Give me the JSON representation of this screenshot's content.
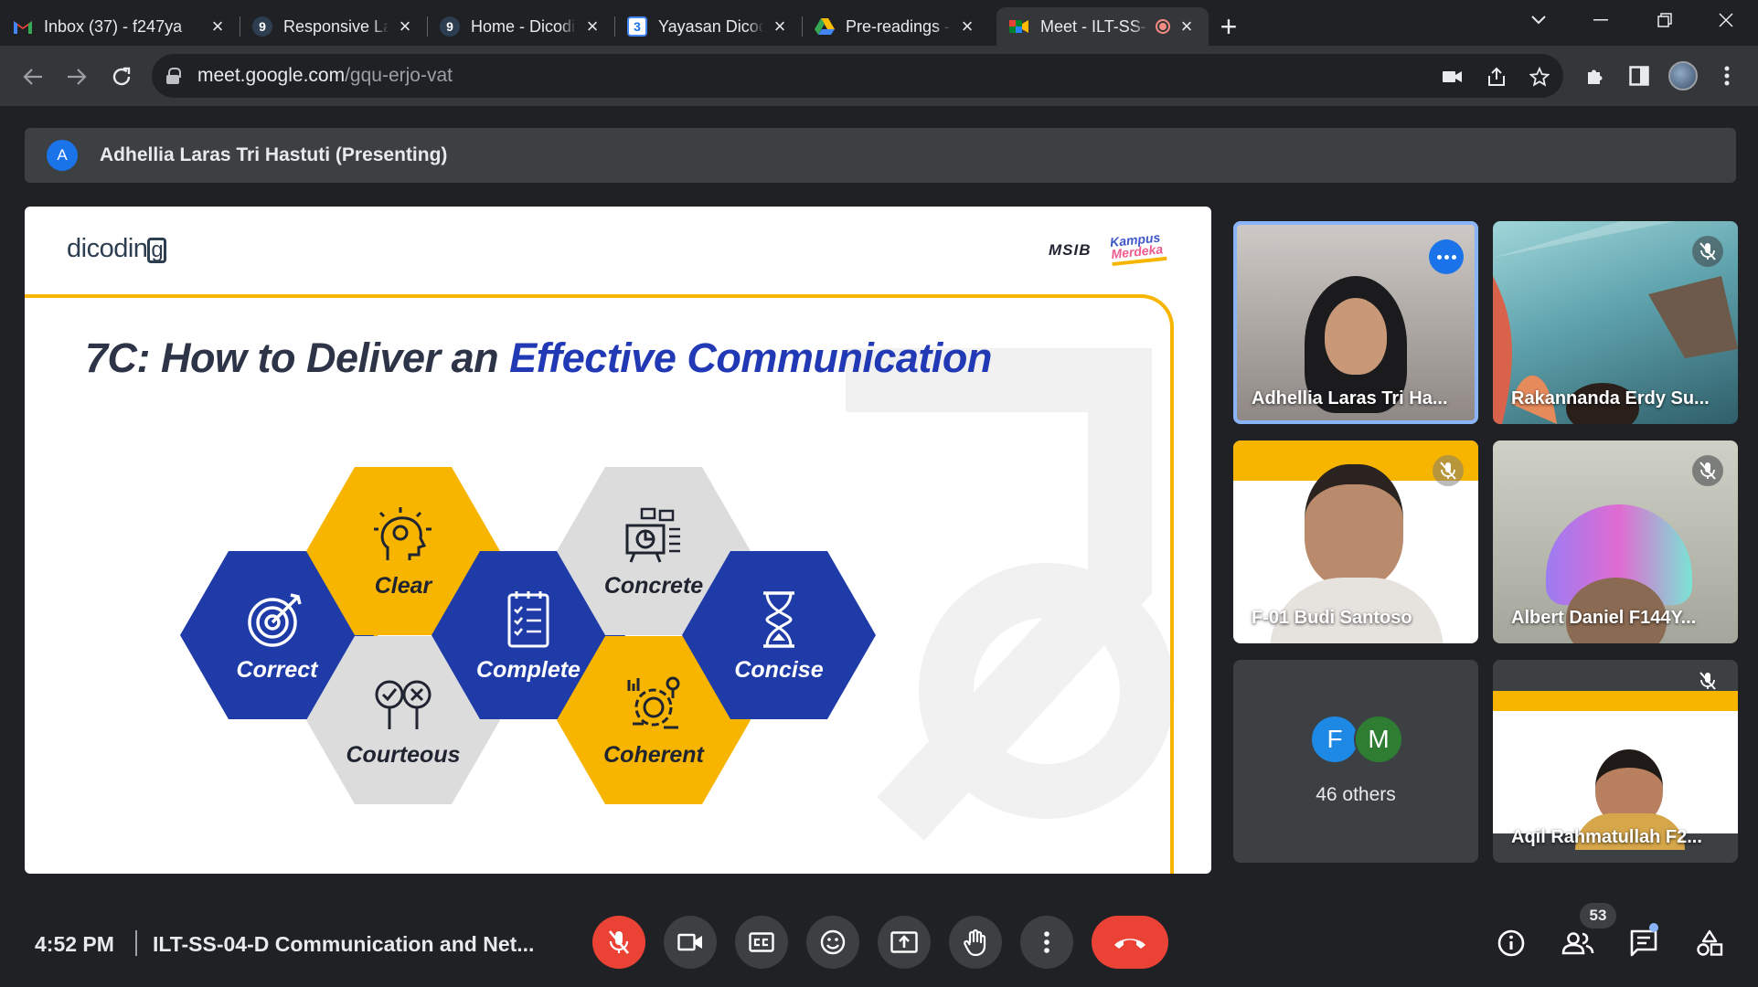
{
  "browser": {
    "tabs": [
      {
        "title": "Inbox (37) - f247ya",
        "favicon": "gmail-icon",
        "active": false
      },
      {
        "title": "Responsive Layout",
        "favicon": "dicoding-icon",
        "active": false
      },
      {
        "title": "Home - Dicoding S",
        "favicon": "dicoding-icon",
        "active": false
      },
      {
        "title": "Yayasan Dicoding I",
        "favicon": "calendar-icon",
        "favicon_text": "3",
        "active": false
      },
      {
        "title": "Pre-readings - SIB",
        "favicon": "drive-icon",
        "active": false
      },
      {
        "title": "Meet - ILT-SS-",
        "favicon": "meet-icon",
        "active": true,
        "recording": true
      }
    ],
    "address": {
      "host": "meet.google.com",
      "path": "/gqu-erjo-vat"
    }
  },
  "meet": {
    "presenter_avatar_letter": "A",
    "presenting_label": "Adhellia Laras Tri Hastuti (Presenting)",
    "slide": {
      "logo": "dicodin",
      "logo_g": "g",
      "partner_logo": "MSIB",
      "kampus_line1": "Kampus",
      "kampus_line2": "Merdeka",
      "title_plain": "7C: How to Deliver an ",
      "title_accent": "Effective Communication",
      "items": [
        {
          "label": "Correct",
          "icon": "target-icon",
          "color": "blue"
        },
        {
          "label": "Clear",
          "icon": "head-gears-icon",
          "color": "yellow"
        },
        {
          "label": "Courteous",
          "icon": "check-cross-icon",
          "color": "grey"
        },
        {
          "label": "Complete",
          "icon": "checklist-icon",
          "color": "blue"
        },
        {
          "label": "Concrete",
          "icon": "presentation-chart-icon",
          "color": "grey"
        },
        {
          "label": "Coherent",
          "icon": "gear-chart-icon",
          "color": "yellow"
        },
        {
          "label": "Concise",
          "icon": "hourglass-icon",
          "color": "blue"
        }
      ],
      "accent_colors": {
        "blue": "#1f3ba8",
        "yellow": "#f7b500",
        "grey": "#dcdcdc"
      }
    },
    "participants": [
      {
        "name": "Adhellia Laras Tri Ha...",
        "speaking": true,
        "muted": false
      },
      {
        "name": "Rakannanda Erdy Su...",
        "muted": true
      },
      {
        "name": "F-01 Budi Santoso",
        "muted": true
      },
      {
        "name": "Albert Daniel F144Y...",
        "muted": true
      },
      {
        "name": "Aqil Rahmatullah F2...",
        "muted": true
      }
    ],
    "others": {
      "avatars": [
        "F",
        "M"
      ],
      "label": "46 others"
    },
    "bottom": {
      "time": "4:52 PM",
      "meeting_name": "ILT-SS-04-D Communication and Net...",
      "people_count": "53"
    }
  }
}
